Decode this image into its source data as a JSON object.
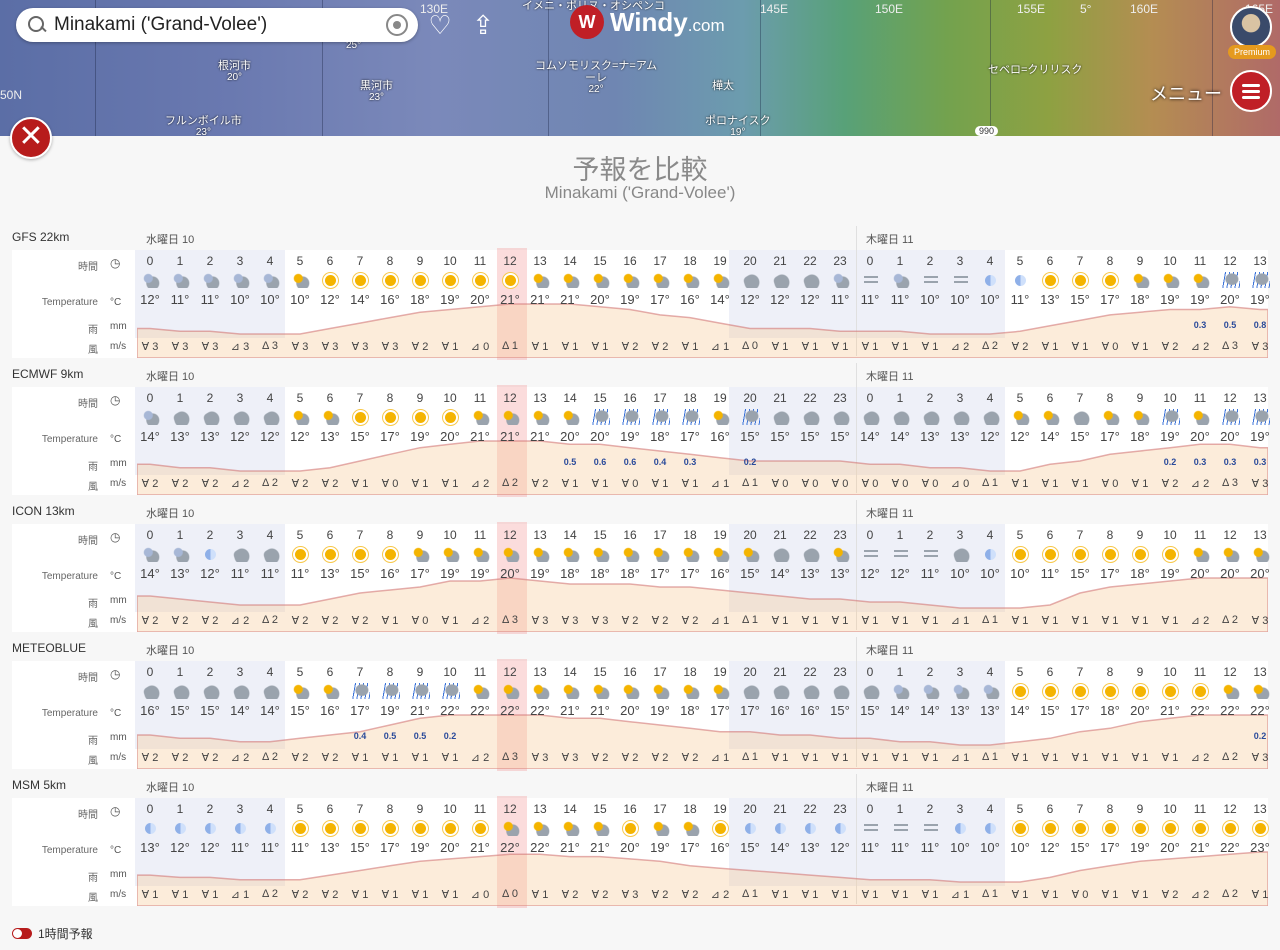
{
  "header": {
    "search_value": "Minakami ('Grand-Volee')",
    "brand": "Windy",
    "brand_suffix": ".com",
    "premium_label": "Premium",
    "menu_label": "メニュー",
    "map_labels": {
      "lon": [
        "130E",
        "145E",
        "150E",
        "155E",
        "160E",
        "165E"
      ],
      "places": [
        {
          "name": "根河市",
          "temp": "20°"
        },
        {
          "name": "黒河市",
          "temp": "23°"
        },
        {
          "name": "コムソモリスク=ナ=アム\nーレ",
          "temp": "22°"
        },
        {
          "name": "樺太",
          "temp": ""
        },
        {
          "name": "フルンボイル市",
          "temp": "23°"
        },
        {
          "name": "ポロナイスク",
          "temp": "19°"
        },
        {
          "name": "セベロ=クリリスク",
          "temp": ""
        },
        {
          "name": "イメニ・ポリヌ・オシペンコ",
          "temp": ""
        }
      ],
      "temp_top": "25°",
      "pressure_chip": "990",
      "lat_label": "50N",
      "lon_5": "5°"
    }
  },
  "panel": {
    "title": "予報を比較",
    "subtitle": "Minakami ('Grand-Volee')"
  },
  "row_labels": {
    "time": "時間",
    "temp": "Temperature",
    "temp_unit": "°C",
    "rain": "雨",
    "rain_unit": "mm",
    "wind": "風",
    "wind_unit": "m/s"
  },
  "days": [
    "水曜日 10",
    "木曜日 11"
  ],
  "hours": [
    "0",
    "1",
    "2",
    "3",
    "4",
    "5",
    "6",
    "7",
    "8",
    "9",
    "10",
    "11",
    "12",
    "13",
    "14",
    "15",
    "16",
    "17",
    "18",
    "19",
    "20",
    "21",
    "22",
    "23",
    "0",
    "1",
    "2",
    "3",
    "4",
    "5",
    "6",
    "7",
    "8",
    "9",
    "10",
    "11",
    "12",
    "13"
  ],
  "models": [
    {
      "name": "GFS 22km",
      "temps": [
        "12°",
        "11°",
        "11°",
        "10°",
        "10°",
        "10°",
        "12°",
        "14°",
        "16°",
        "18°",
        "19°",
        "20°",
        "21°",
        "21°",
        "21°",
        "20°",
        "19°",
        "17°",
        "16°",
        "14°",
        "12°",
        "12°",
        "12°",
        "11°",
        "11°",
        "11°",
        "10°",
        "10°",
        "10°",
        "11°",
        "13°",
        "15°",
        "17°",
        "18°",
        "19°",
        "19°",
        "20°",
        "19°"
      ],
      "icons": [
        "ncl",
        "ncl",
        "ncl",
        "ncl",
        "ncl",
        "pcs",
        "sun",
        "sun",
        "sun",
        "sun",
        "sun",
        "sun",
        "sun",
        "pcs",
        "pcs",
        "pcs",
        "pcs",
        "pcs",
        "pcs",
        "pcs",
        "cld",
        "cld",
        "cld",
        "ncl",
        "fog",
        "ncl",
        "fog",
        "fog",
        "moon",
        "moon",
        "sun",
        "sun",
        "sun",
        "pcs",
        "pcs",
        "pcs",
        "rain",
        "rain"
      ],
      "rain": [
        "",
        "",
        "",
        "",
        "",
        "",
        "",
        "",
        "",
        "",
        "",
        "",
        "",
        "",
        "",
        "",
        "",
        "",
        "",
        "",
        "",
        "",
        "",
        "",
        "",
        "",
        "",
        "",
        "",
        "",
        "",
        "",
        "",
        "",
        "",
        "0.3",
        "0.5",
        "0.8"
      ],
      "wind": [
        "3",
        "3",
        "3",
        "3",
        "3",
        "3",
        "3",
        "3",
        "3",
        "2",
        "1",
        "0",
        "1",
        "1",
        "1",
        "1",
        "2",
        "2",
        "1",
        "1",
        "0",
        "1",
        "1",
        "1",
        "1",
        "1",
        "1",
        "2",
        "2",
        "2",
        "1",
        "1",
        "0",
        "1",
        "2",
        "2",
        "3",
        "3"
      ]
    },
    {
      "name": "ECMWF 9km",
      "temps": [
        "14°",
        "13°",
        "13°",
        "12°",
        "12°",
        "12°",
        "13°",
        "15°",
        "17°",
        "19°",
        "20°",
        "21°",
        "21°",
        "21°",
        "20°",
        "20°",
        "19°",
        "18°",
        "17°",
        "16°",
        "15°",
        "15°",
        "15°",
        "15°",
        "14°",
        "14°",
        "13°",
        "13°",
        "12°",
        "12°",
        "14°",
        "15°",
        "17°",
        "18°",
        "19°",
        "20°",
        "20°",
        "19°"
      ],
      "icons": [
        "ncl",
        "cld",
        "cld",
        "cld",
        "cld",
        "pcs",
        "pcs",
        "sun",
        "sun",
        "sun",
        "sun",
        "pcs",
        "pcs",
        "pcs",
        "pcs",
        "rain",
        "rain",
        "rain",
        "rain",
        "pcs",
        "rain",
        "cld",
        "cld",
        "cld",
        "cld",
        "cld",
        "cld",
        "cld",
        "cld",
        "pcs",
        "pcs",
        "cld",
        "pcs",
        "pcs",
        "rain",
        "pcs",
        "rain",
        "rain"
      ],
      "rain": [
        "",
        "",
        "",
        "",
        "",
        "",
        "",
        "",
        "",
        "",
        "",
        "",
        "",
        "",
        "0.5",
        "0.6",
        "0.6",
        "0.4",
        "0.3",
        "",
        "0.2",
        "",
        "",
        "",
        "",
        "",
        "",
        "",
        "",
        "",
        "",
        "",
        "",
        "",
        "0.2",
        "0.3",
        "0.3",
        "0.3"
      ],
      "wind": [
        "2",
        "2",
        "2",
        "2",
        "2",
        "2",
        "2",
        "1",
        "0",
        "1",
        "1",
        "2",
        "2",
        "2",
        "1",
        "1",
        "0",
        "1",
        "1",
        "1",
        "1",
        "0",
        "0",
        "0",
        "0",
        "0",
        "0",
        "0",
        "1",
        "1",
        "1",
        "1",
        "0",
        "1",
        "2",
        "2",
        "3",
        "3"
      ]
    },
    {
      "name": "ICON 13km",
      "temps": [
        "14°",
        "13°",
        "12°",
        "11°",
        "11°",
        "11°",
        "13°",
        "15°",
        "16°",
        "17°",
        "19°",
        "19°",
        "20°",
        "19°",
        "18°",
        "18°",
        "18°",
        "17°",
        "17°",
        "16°",
        "15°",
        "14°",
        "13°",
        "13°",
        "12°",
        "12°",
        "11°",
        "10°",
        "10°",
        "10°",
        "11°",
        "15°",
        "17°",
        "18°",
        "19°",
        "20°",
        "20°",
        "20°"
      ],
      "icons": [
        "ncl",
        "ncl",
        "moon",
        "cld",
        "cld",
        "sun",
        "sun",
        "sun",
        "sun",
        "pcs",
        "pcs",
        "pcs",
        "pcs",
        "pcs",
        "pcs",
        "pcs",
        "pcs",
        "pcs",
        "pcs",
        "pcs",
        "pcs",
        "cld",
        "cld",
        "pcs",
        "fog",
        "fog",
        "fog",
        "cld",
        "moon",
        "sun",
        "sun",
        "sun",
        "sun",
        "sun",
        "sun",
        "pcs",
        "pcs",
        "pcs"
      ],
      "rain": [
        "",
        "",
        "",
        "",
        "",
        "",
        "",
        "",
        "",
        "",
        "",
        "",
        "",
        "",
        "",
        "",
        "",
        "",
        "",
        "",
        "",
        "",
        "",
        "",
        "",
        "",
        "",
        "",
        "",
        "",
        "",
        "",
        "",
        "",
        "",
        "",
        "",
        ""
      ],
      "wind": [
        "2",
        "2",
        "2",
        "2",
        "2",
        "2",
        "2",
        "2",
        "1",
        "0",
        "1",
        "2",
        "3",
        "3",
        "3",
        "3",
        "2",
        "2",
        "2",
        "1",
        "1",
        "1",
        "1",
        "1",
        "1",
        "1",
        "1",
        "1",
        "1",
        "1",
        "1",
        "1",
        "1",
        "1",
        "1",
        "2",
        "2",
        "3"
      ]
    },
    {
      "name": "METEOBLUE",
      "temps": [
        "16°",
        "15°",
        "15°",
        "14°",
        "14°",
        "15°",
        "16°",
        "17°",
        "19°",
        "21°",
        "22°",
        "22°",
        "22°",
        "22°",
        "21°",
        "21°",
        "20°",
        "19°",
        "18°",
        "17°",
        "17°",
        "16°",
        "16°",
        "15°",
        "15°",
        "14°",
        "14°",
        "13°",
        "13°",
        "14°",
        "15°",
        "17°",
        "18°",
        "20°",
        "21°",
        "22°",
        "22°",
        "22°"
      ],
      "icons": [
        "cld",
        "cld",
        "cld",
        "cld",
        "cld",
        "pcs",
        "pcs",
        "rain",
        "rain",
        "rain",
        "rain",
        "pcs",
        "pcs",
        "pcs",
        "pcs",
        "pcs",
        "pcs",
        "pcs",
        "pcs",
        "pcs",
        "cld",
        "cld",
        "cld",
        "cld",
        "cld",
        "ncl",
        "ncl",
        "ncl",
        "ncl",
        "sun",
        "sun",
        "sun",
        "sun",
        "sun",
        "sun",
        "sun",
        "pcs",
        "pcs"
      ],
      "rain": [
        "",
        "",
        "",
        "",
        "",
        "",
        "",
        "0.4",
        "0.5",
        "0.5",
        "0.2",
        "",
        "",
        "",
        "",
        "",
        "",
        "",
        "",
        "",
        "",
        "",
        "",
        "",
        "",
        "",
        "",
        "",
        "",
        "",
        "",
        "",
        "",
        "",
        "",
        "",
        "",
        "0.2"
      ],
      "wind": [
        "2",
        "2",
        "2",
        "2",
        "2",
        "2",
        "2",
        "1",
        "1",
        "1",
        "1",
        "2",
        "3",
        "3",
        "3",
        "2",
        "2",
        "2",
        "2",
        "1",
        "1",
        "1",
        "1",
        "1",
        "1",
        "1",
        "1",
        "1",
        "1",
        "1",
        "1",
        "1",
        "1",
        "1",
        "1",
        "2",
        "2",
        "3"
      ]
    },
    {
      "name": "MSM 5km",
      "temps": [
        "13°",
        "12°",
        "12°",
        "11°",
        "11°",
        "11°",
        "13°",
        "15°",
        "17°",
        "19°",
        "20°",
        "21°",
        "22°",
        "22°",
        "21°",
        "21°",
        "20°",
        "19°",
        "17°",
        "16°",
        "15°",
        "14°",
        "13°",
        "12°",
        "11°",
        "11°",
        "11°",
        "10°",
        "10°",
        "10°",
        "12°",
        "15°",
        "17°",
        "19°",
        "20°",
        "21°",
        "22°",
        "23°"
      ],
      "icons": [
        "moon",
        "moon",
        "moon",
        "moon",
        "moon",
        "sun",
        "sun",
        "sun",
        "sun",
        "sun",
        "sun",
        "sun",
        "pcs",
        "pcs",
        "pcs",
        "pcs",
        "sun",
        "pcs",
        "pcs",
        "sun",
        "moon",
        "moon",
        "moon",
        "moon",
        "fog",
        "fog",
        "fog",
        "moon",
        "moon",
        "sun",
        "sun",
        "sun",
        "sun",
        "sun",
        "sun",
        "sun",
        "sun",
        "sun"
      ],
      "rain": [
        "",
        "",
        "",
        "",
        "",
        "",
        "",
        "",
        "",
        "",
        "",
        "",
        "",
        "",
        "",
        "",
        "",
        "",
        "",
        "",
        "",
        "",
        "",
        "",
        "",
        "",
        "",
        "",
        "",
        "",
        "",
        "",
        "",
        "",
        "",
        "",
        "",
        ""
      ],
      "wind": [
        "1",
        "1",
        "1",
        "1",
        "2",
        "2",
        "2",
        "1",
        "1",
        "1",
        "1",
        "0",
        "0",
        "1",
        "2",
        "2",
        "3",
        "2",
        "2",
        "2",
        "1",
        "1",
        "1",
        "1",
        "1",
        "1",
        "1",
        "1",
        "1",
        "1",
        "1",
        "0",
        "1",
        "1",
        "2",
        "2",
        "2",
        "1"
      ]
    }
  ],
  "footer": {
    "toggle_label": "1時間予報"
  },
  "colors": {
    "accent": "#c01f26",
    "night": "#eef0f8",
    "highlight": "#f7d9d9"
  }
}
